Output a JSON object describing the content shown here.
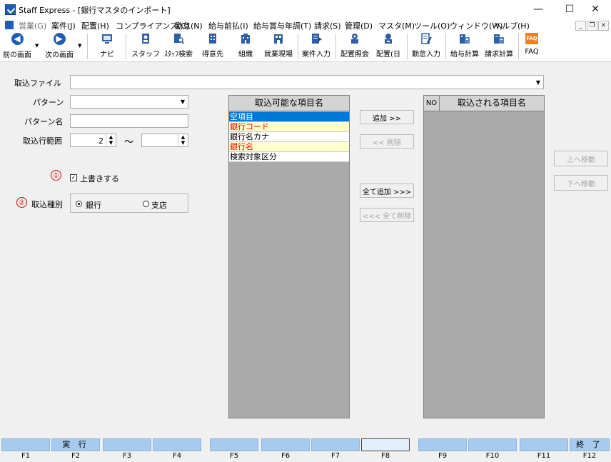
{
  "window": {
    "title": "Staff Express - [銀行マスタのインポート]",
    "min": "—",
    "max": "☐",
    "close": "✕"
  },
  "menu": {
    "items": [
      "営業(G)",
      "案件(J)",
      "配置(H)",
      "コンプライアンス(C)",
      "勤怠(N)",
      "給与前払(I)",
      "給与賞与年調(T)",
      "請求(S)",
      "管理(D)",
      "マスタ(M)",
      "ツール(O)",
      "ウィンドウ(W)",
      "ヘルプ(H)"
    ],
    "mdi_min": "_",
    "mdi_restore": "❐",
    "mdi_close": "✕"
  },
  "toolbar": {
    "prev": "前の画面",
    "next": "次の画面",
    "navi": "ナビ",
    "staff": "スタッフ",
    "staff_search": "ｽﾀｯﾌ検索",
    "client": "得意先",
    "org": "組織",
    "worksite": "就業現場",
    "case_input": "案件入力",
    "placement_inquiry": "配置照会",
    "placement_day": "配置(日",
    "attendance_input": "勤怠入力",
    "payroll_calc": "給与計算",
    "billing_calc": "請求計算",
    "faq": "FAQ",
    "faq_logo": "FAQ"
  },
  "form": {
    "import_file_label": "取込ファイル",
    "import_file_value": "",
    "pattern_label": "パターン",
    "pattern_value": "",
    "pattern_name_label": "パターン名",
    "pattern_name_value": "",
    "range_label": "取込行範囲",
    "range_from": "2",
    "range_sep": "～",
    "range_to": "",
    "marker1": "①",
    "overwrite_label": "上書きする",
    "marker2": "②",
    "import_type_label": "取込種別",
    "radio_bank": "銀行",
    "radio_branch": "支店"
  },
  "available": {
    "header": "取込可能な項目名",
    "items": [
      {
        "label": "空項目",
        "state": "selected"
      },
      {
        "label": "銀行コード",
        "state": "required"
      },
      {
        "label": "銀行名カナ",
        "state": "normal"
      },
      {
        "label": "銀行名",
        "state": "required"
      },
      {
        "label": "検索対象区分",
        "state": "normal"
      }
    ]
  },
  "buttons": {
    "add": "追加 >>",
    "delete": "<< 削除",
    "add_all": "全て追加 >>>",
    "delete_all": "<<< 全て削除",
    "move_up": "上へ移動",
    "move_down": "下へ移動"
  },
  "imported": {
    "no_header": "NO",
    "header": "取込される項目名"
  },
  "fkeys": [
    {
      "key": "F1",
      "label": ""
    },
    {
      "key": "F2",
      "label": "実 行"
    },
    {
      "key": "F3",
      "label": ""
    },
    {
      "key": "F4",
      "label": ""
    },
    {
      "key": "F5",
      "label": ""
    },
    {
      "key": "F6",
      "label": ""
    },
    {
      "key": "F7",
      "label": ""
    },
    {
      "key": "F8",
      "label": ""
    },
    {
      "key": "F9",
      "label": ""
    },
    {
      "key": "F10",
      "label": ""
    },
    {
      "key": "F11",
      "label": ""
    },
    {
      "key": "F12",
      "label": "終 了"
    }
  ],
  "colors": {
    "selected_bg": "#0078d7",
    "required_text": "#ff0000",
    "required_bg": "#ffffcc",
    "fkey_bg": "#a6caf0"
  }
}
